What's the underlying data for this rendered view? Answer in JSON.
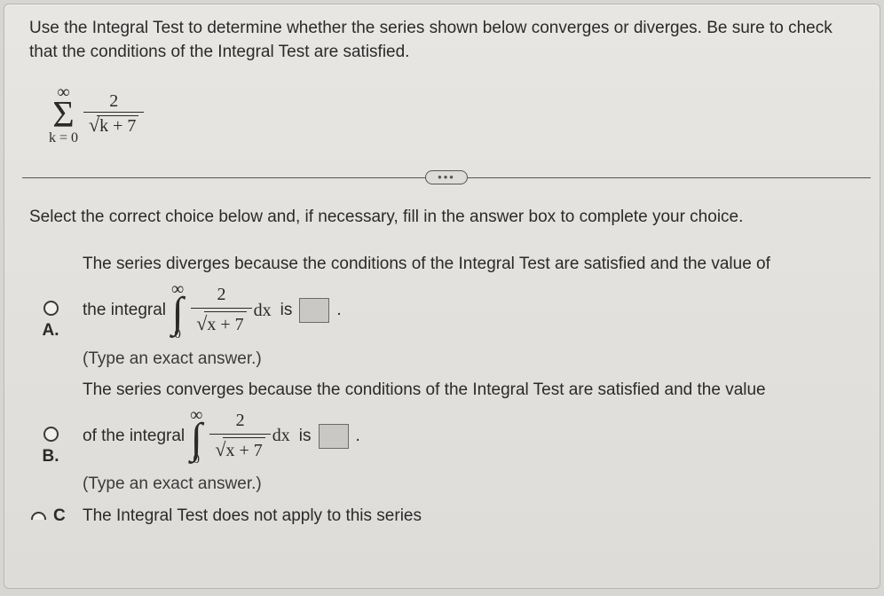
{
  "prompt": "Use the Integral Test to determine whether the series shown below converges or diverges. Be sure to check that the conditions of the Integral Test are satisfied.",
  "series": {
    "upper": "∞",
    "lower": "k = 0",
    "numerator": "2",
    "radicand": "k + 7"
  },
  "divider_dots": "…",
  "instruction": "Select the correct choice below and, if necessary, fill in the answer box to complete your choice.",
  "choices": {
    "A": {
      "label": "A.",
      "line1": "The series diverges because the conditions of the Integral Test are satisfied and the value of",
      "lead": "the integral",
      "int_upper": "∞",
      "int_lower": "0",
      "int_num": "2",
      "int_radicand": "x + 7",
      "dx": "dx",
      "is": "is",
      "period": ".",
      "hint": "(Type an exact answer.)"
    },
    "B": {
      "label": "B.",
      "line1": "The series converges because the conditions of the Integral Test are satisfied and the value",
      "lead": "of the integral",
      "int_upper": "∞",
      "int_lower": "0",
      "int_num": "2",
      "int_radicand": "x + 7",
      "dx": "dx",
      "is": "is",
      "period": ".",
      "hint": "(Type an exact answer.)"
    },
    "C": {
      "label_partial": "C",
      "text": "The Integral Test does not apply to this series"
    }
  }
}
